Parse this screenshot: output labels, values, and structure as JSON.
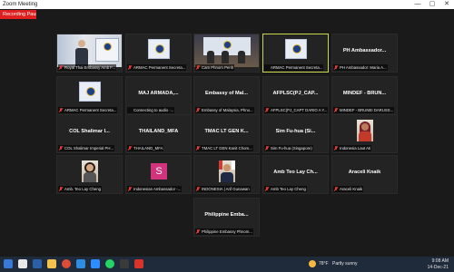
{
  "window": {
    "title": "Zoom Meeting",
    "recording": "Recording Paused",
    "controls": [
      "—",
      "▢",
      "✕"
    ]
  },
  "tiles": [
    {
      "name": "",
      "label": "Royal Thai Embassy Amb F...",
      "type": "video-room1",
      "muted": true
    },
    {
      "name": "",
      "label": "ARMAC Permanent Secreta...",
      "type": "flag",
      "muted": true
    },
    {
      "name": "",
      "label": "Cam Phnom Penh",
      "type": "video-room2",
      "muted": true
    },
    {
      "name": "",
      "label": "ARMAC Permanent Secreta...",
      "type": "flag",
      "muted": false,
      "active": true
    },
    {
      "name": "PH Ambassador...",
      "label": "PH Ambassador: Maria A...",
      "type": "name",
      "muted": true
    },
    {
      "name": "",
      "label": "ARMAC Permanent Secreta...",
      "type": "flag",
      "muted": true
    },
    {
      "name": "MAJ ARMADA,...",
      "label": "Connecting to audio ·...",
      "type": "name",
      "muted": false
    },
    {
      "name": "Embassy of Mal...",
      "label": "Embassy of Malaysia, Phno...",
      "type": "name",
      "muted": true
    },
    {
      "name": "AFPLSC(PJ_CAP...",
      "label": "AFPLSC(PJ_CAPT DARIO A Y...",
      "type": "name",
      "muted": true
    },
    {
      "name": "MINDEF - BRUN...",
      "label": "MINDEF - BRUNEI DARUSS...",
      "type": "name",
      "muted": true
    },
    {
      "name": "COL Shalimar I...",
      "label": "COL Shalimar Imperial PH...",
      "type": "name",
      "muted": true
    },
    {
      "name": "THAILAND_MFA",
      "label": "THAILAND_MFA",
      "type": "name",
      "muted": true
    },
    {
      "name": "TMAC LT GEN K...",
      "label": "TMAC LT GEN Kanit Chom...",
      "type": "name",
      "muted": true
    },
    {
      "name": "Sim Fu-hua (Si...",
      "label": "Sim Fu-hua (Singapore)",
      "type": "name",
      "muted": true
    },
    {
      "name": "",
      "label": "Indonesia Laut Ati",
      "type": "photo-woman",
      "muted": true
    },
    {
      "name": "",
      "label": "Amb. Teo Lay Cheng",
      "type": "photo-woman2",
      "muted": true
    },
    {
      "name": "",
      "label": "Indonesian Ambassador -...",
      "type": "avatar",
      "initial": "S",
      "muted": true
    },
    {
      "name": "",
      "label": "INDONESIA | Arif Gunawan",
      "type": "photo-man2",
      "muted": true
    },
    {
      "name": "Amb Teo Lay Ch...",
      "label": "Amb Teo Lay Cheng",
      "type": "name",
      "muted": true
    },
    {
      "name": "Araceli Knaik",
      "label": "Araceli Knaik",
      "type": "name",
      "muted": true
    },
    {
      "name": "Philippine Emba...",
      "label": "Philippine Embassy Phnom...",
      "type": "name",
      "muted": true
    }
  ],
  "taskbar": {
    "weather_temp": "78°F",
    "weather_text": "Partly sunny",
    "time": "9:08 AM",
    "date": "14-Dec-21"
  },
  "colors": {
    "active_border": "#c8d84a",
    "record_bg": "#e02020",
    "muted_icon": "#e53935",
    "tile_bg": "#232323",
    "taskbar_bg": "#1f2a3a"
  }
}
